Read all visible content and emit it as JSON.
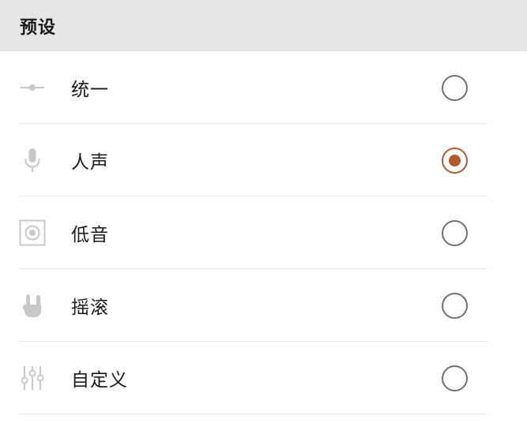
{
  "header": {
    "title": "预设"
  },
  "accent_color": "#b4582d",
  "presets": [
    {
      "label": "统一",
      "icon": "slider-flat-icon",
      "selected": false
    },
    {
      "label": "人声",
      "icon": "microphone-icon",
      "selected": true
    },
    {
      "label": "低音",
      "icon": "speaker-icon",
      "selected": false
    },
    {
      "label": "摇滚",
      "icon": "rock-hand-icon",
      "selected": false
    },
    {
      "label": "自定义",
      "icon": "equalizer-sliders-icon",
      "selected": false
    }
  ]
}
